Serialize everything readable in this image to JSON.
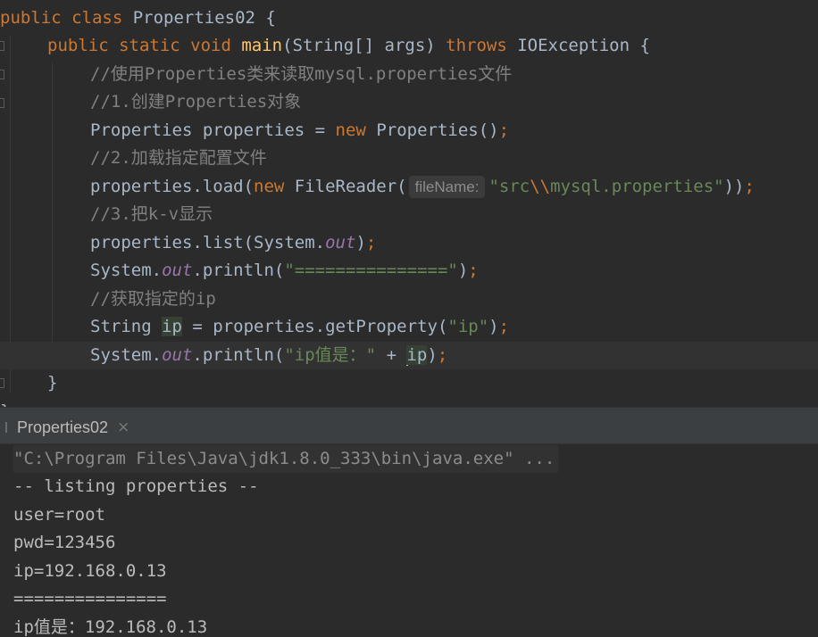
{
  "editor": {
    "l1": {
      "kw": "public class ",
      "cls": "Properties02 {"
    },
    "l2": {
      "kw": "public static void ",
      "fn": "main",
      "params": "(String[] args) ",
      "throws": "throws ",
      "exc": "IOException {"
    },
    "l3": {
      "comment": "//使用Properties类来读取mysql.properties文件"
    },
    "l4": {
      "comment": "//1.创建Properties对象"
    },
    "l5": {
      "pre": "Properties properties = ",
      "kw": "new ",
      "post": "Properties()",
      "semi": ";"
    },
    "l6": {
      "comment": "//2.加载指定配置文件"
    },
    "l7": {
      "pre": "properties.load(",
      "kw": "new ",
      "mid": "FileReader(",
      "hint": "fileName:",
      "str1": "\"src",
      "esc": "\\\\",
      "str2": "mysql.properties\"",
      "post": "))",
      "semi": ";"
    },
    "l8": {
      "comment": "//3.把k-v显示"
    },
    "l9": {
      "pre": "properties.list(System.",
      "field": "out",
      "post": ")",
      "semi": ";"
    },
    "l10": {
      "pre": "System.",
      "field": "out",
      "mid": ".println(",
      "str": "\"===============\"",
      "post": ")",
      "semi": ";"
    },
    "l11": {
      "comment": "//获取指定的ip"
    },
    "l12": {
      "pre": "String ",
      "var": "ip",
      "mid": " = properties.getProperty(",
      "str": "\"ip\"",
      "post": ")",
      "semi": ";"
    },
    "l13": {
      "pre": "System.",
      "field": "out",
      "mid": ".println(",
      "str": "\"ip值是：\"",
      "plus": " + ",
      "var": "ip",
      "post": ")",
      "semi": ";"
    },
    "l14": {
      "brace": "}"
    },
    "l15": {
      "brace": "}"
    }
  },
  "run_tab": {
    "label": "Properties02",
    "close": "×"
  },
  "console": {
    "cmd": "\"C:\\Program Files\\Java\\jdk1.8.0_333\\bin\\java.exe\" ...",
    "lines": [
      "-- listing properties --",
      "user=root",
      "pwd=123456",
      "ip=192.168.0.13",
      "===============",
      "ip值是：192.168.0.13"
    ]
  }
}
